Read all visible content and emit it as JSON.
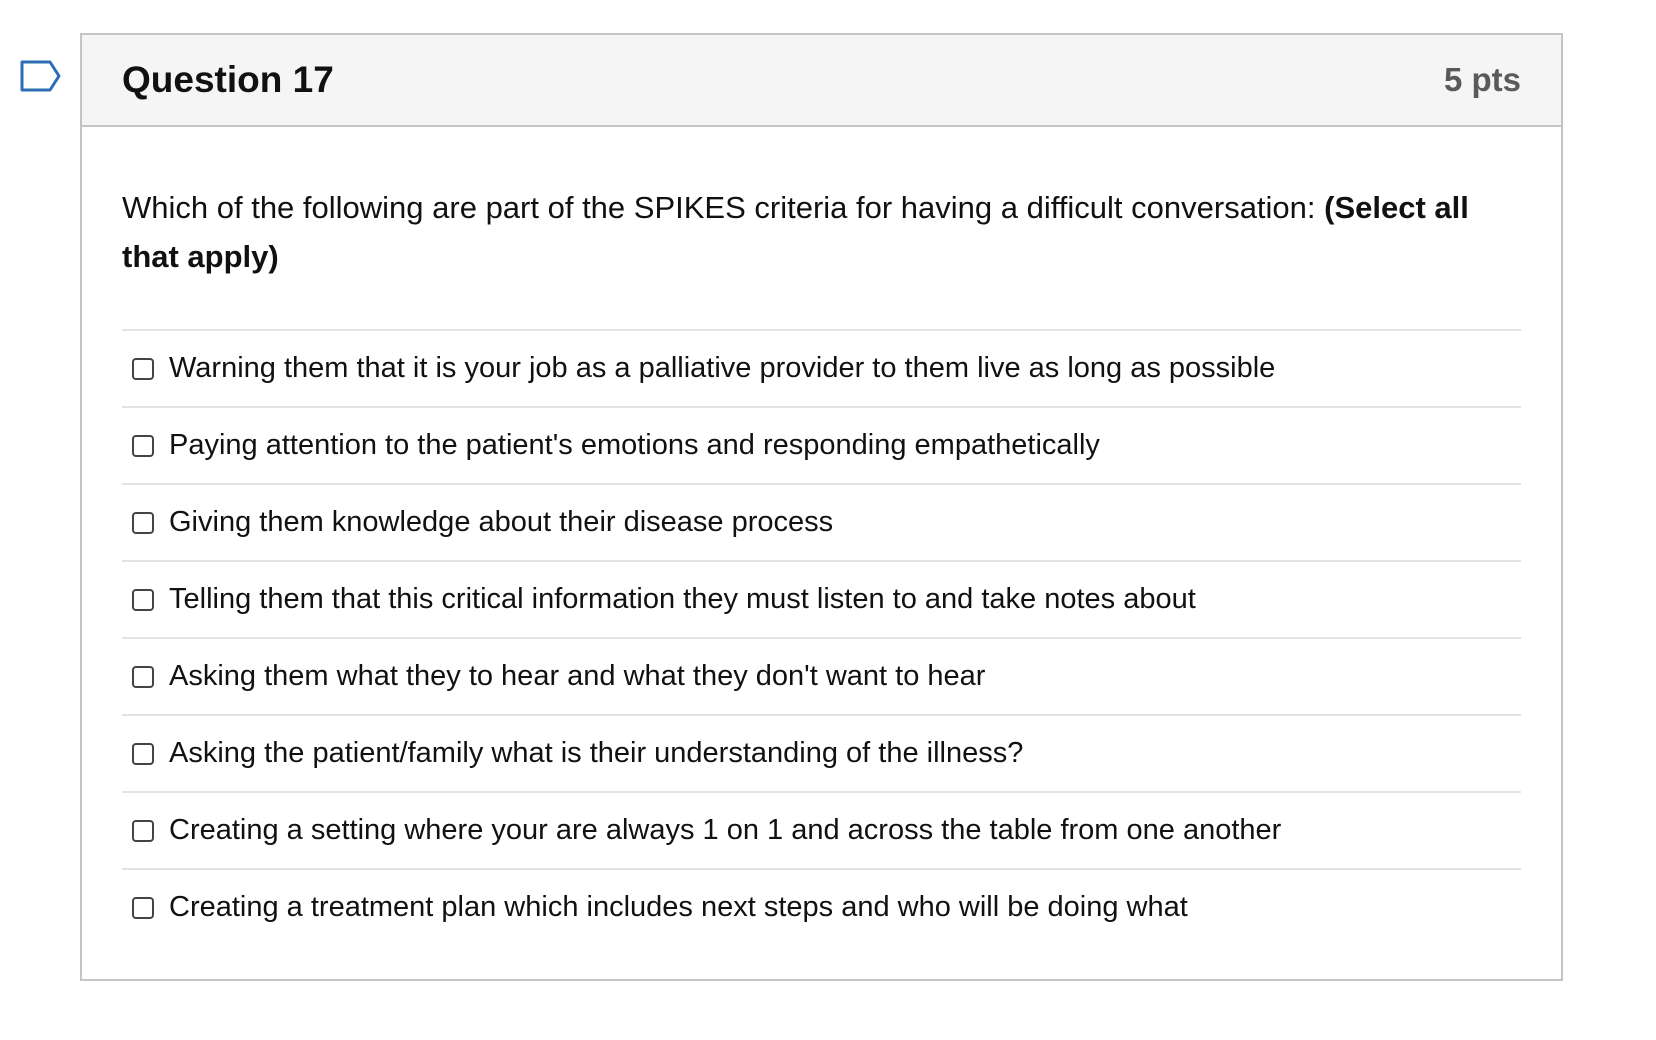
{
  "question": {
    "title": "Question 17",
    "points": "5 pts",
    "text": "Which of the following are part of the SPIKES criteria for having a difficult conversation: ",
    "instruction": "(Select all that apply)",
    "flag_icon": "bookmark-flag-icon",
    "accent_color": "#2d6db5"
  },
  "answers": [
    {
      "label": "Warning them that it is your job as a palliative provider to them live as long as possible",
      "checked": false
    },
    {
      "label": "Paying attention to the patient's emotions and responding empathetically",
      "checked": false
    },
    {
      "label": "Giving them knowledge about their disease process",
      "checked": false
    },
    {
      "label": "Telling them that this critical information they must listen to and take notes about",
      "checked": false
    },
    {
      "label": "Asking them what they to hear and what they don't want to hear",
      "checked": false
    },
    {
      "label": "Asking the patient/family what is their understanding of the illness?",
      "checked": false
    },
    {
      "label": "Creating a setting where your are always 1 on 1 and across the table from one another",
      "checked": false
    },
    {
      "label": "Creating a treatment plan which includes next steps and who will be doing what",
      "checked": false
    }
  ]
}
